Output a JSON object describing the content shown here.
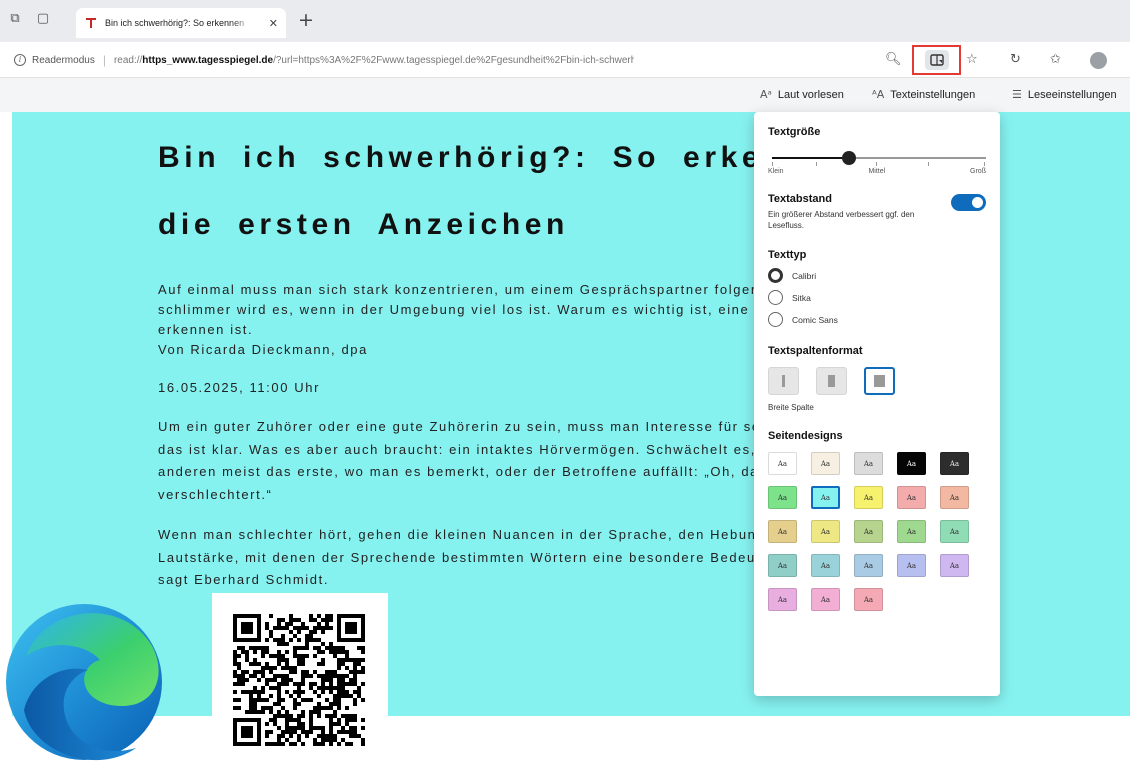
{
  "browser": {
    "tab": {
      "title": "Bin ich schwerhörig?: So erkennen"
    },
    "address": {
      "mode_label": "Readermodus",
      "url_prefix": "read://",
      "url_host": "https_www.tagesspiegel.de",
      "url_rest": "/?url=https%3A%2F%2Fwww.tagesspiegel.de%2Fgesundheit%2Fbin-ich-schwerhorig-..."
    }
  },
  "reader_toolbar": {
    "read_aloud": "Laut vorlesen",
    "text_settings": "Texteinstellungen",
    "reading_prefs": "Leseeinstellungen"
  },
  "article": {
    "headline": "Bin ich schwerhörig?: So erkennen Sie die ersten Anzeichen",
    "lead": "Auf einmal muss man sich stark konzentrieren, um einem Gesprächspartner folgen zu können. Noch schlimmer wird es, wenn in der Umgebung viel los ist. Warum es wichtig ist, eine Hörschwäche rechtzeitig zu erkennen ist.",
    "author": "Von Ricarda Dieckmann, dpa",
    "date": "16.05.2025, 11:00 Uhr",
    "paragraph1": "Um ein guter Zuhörer oder eine gute Zuhörerin zu sein, muss man Interesse für sein Gegenüber mitbringen – das ist klar. Was es aber auch braucht: ein intaktes Hörvermögen. Schwächelt es, sind Gespräche mit anderen meist das erste, wo man es bemerkt, oder der Betroffene auffällt: „Oh, da hat sich etwas verschlechtert.“",
    "paragraph2": "Wenn man schlechter hört, gehen die kleinen Nuancen in der Sprache, den Hebungen und Senken der Lautstärke, mit denen der Sprechende bestimmten Wörtern eine besondere Bedeutung verleihen möchte“, sagt Eberhard Schmidt."
  },
  "text_settings_panel": {
    "text_size": {
      "heading": "Textgröße",
      "labels": [
        "Klein",
        "Mittel",
        "Groß"
      ],
      "level": 0.36
    },
    "spacing": {
      "heading": "Textabstand",
      "description": "Ein größerer Abstand verbessert ggf. den Lesefluss.",
      "enabled": true
    },
    "font_type": {
      "heading": "Texttyp",
      "options": [
        "Calibri",
        "Sitka",
        "Comic Sans"
      ],
      "selected": "Calibri"
    },
    "columns": {
      "heading": "Textspaltenformat",
      "selected_label": "Breite Spalte",
      "selected_index": 2
    },
    "themes": {
      "heading": "Seitendesigns",
      "swatch_label": "Aa",
      "selected_index": 6,
      "colors": [
        {
          "bg": "#ffffff",
          "fg": "#333333"
        },
        {
          "bg": "#f6efe2",
          "fg": "#333333"
        },
        {
          "bg": "#dcdcdc",
          "fg": "#333333"
        },
        {
          "bg": "#050505",
          "fg": "#ffffff"
        },
        {
          "bg": "#2d2d2d",
          "fg": "#eeeeee"
        },
        {
          "bg": "#7de38b",
          "fg": "#333333"
        },
        {
          "bg": "#86f2f0",
          "fg": "#333333"
        },
        {
          "bg": "#f7f26d",
          "fg": "#333333"
        },
        {
          "bg": "#f4abab",
          "fg": "#333333"
        },
        {
          "bg": "#f2b8a1",
          "fg": "#333333"
        },
        {
          "bg": "#e5cf8d",
          "fg": "#333333"
        },
        {
          "bg": "#ede884",
          "fg": "#333333"
        },
        {
          "bg": "#b7d48e",
          "fg": "#333333"
        },
        {
          "bg": "#9fd98f",
          "fg": "#333333"
        },
        {
          "bg": "#8fdcb5",
          "fg": "#333333"
        },
        {
          "bg": "#8fcfc8",
          "fg": "#333333"
        },
        {
          "bg": "#99d3d9",
          "fg": "#333333"
        },
        {
          "bg": "#a9cbe3",
          "fg": "#333333"
        },
        {
          "bg": "#b7bff0",
          "fg": "#333333"
        },
        {
          "bg": "#cfb7ef",
          "fg": "#333333"
        },
        {
          "bg": "#e8aee0",
          "fg": "#333333"
        },
        {
          "bg": "#f3aed3",
          "fg": "#333333"
        },
        {
          "bg": "#f4a9b5",
          "fg": "#333333"
        }
      ]
    }
  },
  "colors": {
    "page_background": "#86f2f0",
    "accent": "#0f6cbd",
    "highlight": "#e53935"
  }
}
